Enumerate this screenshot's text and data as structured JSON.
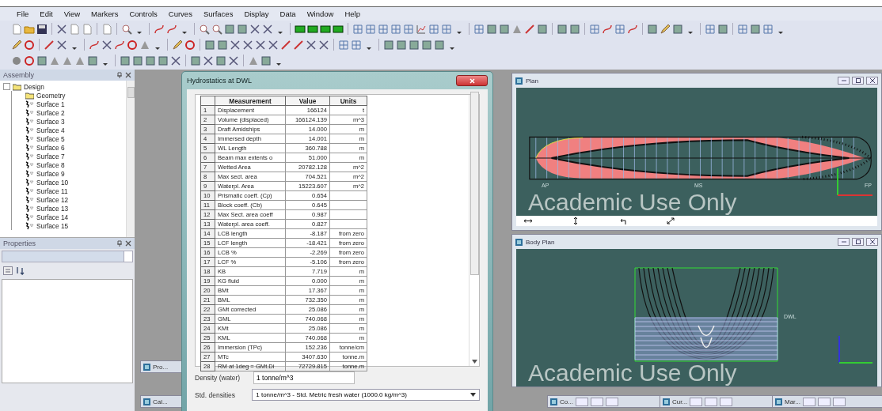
{
  "menu": [
    "File",
    "Edit",
    "View",
    "Markers",
    "Controls",
    "Curves",
    "Surfaces",
    "Display",
    "Data",
    "Window",
    "Help"
  ],
  "assembly": {
    "title": "Assembly",
    "tree": [
      {
        "label": "Design",
        "kind": "folder",
        "expanded": true,
        "children": [
          {
            "label": "Geometry",
            "kind": "folder"
          },
          {
            "label": "Surface 1",
            "kind": "surface"
          },
          {
            "label": "Surface 2",
            "kind": "surface"
          },
          {
            "label": "Surface 3",
            "kind": "surface"
          },
          {
            "label": "Surface 4",
            "kind": "surface"
          },
          {
            "label": "Surface 5",
            "kind": "surface"
          },
          {
            "label": "Surface 6",
            "kind": "surface"
          },
          {
            "label": "Surface 7",
            "kind": "surface"
          },
          {
            "label": "Surface 8",
            "kind": "surface"
          },
          {
            "label": "Surface 9",
            "kind": "surface"
          },
          {
            "label": "Surface 10",
            "kind": "surface"
          },
          {
            "label": "Surface 11",
            "kind": "surface"
          },
          {
            "label": "Surface 12",
            "kind": "surface"
          },
          {
            "label": "Surface 13",
            "kind": "surface"
          },
          {
            "label": "Surface 14",
            "kind": "surface"
          },
          {
            "label": "Surface 15",
            "kind": "surface"
          }
        ]
      }
    ]
  },
  "properties": {
    "title": "Properties"
  },
  "minimized_left": [
    {
      "title": "Pro..."
    },
    {
      "title": "Cal..."
    }
  ],
  "dialog": {
    "title": "Hydrostatics at DWL",
    "table": {
      "columns": [
        "Measurement",
        "Value",
        "Units"
      ],
      "rows": [
        {
          "index": "1",
          "measurement": "Displacement",
          "value": "166124",
          "units": "t"
        },
        {
          "index": "2",
          "measurement": "Volume (displaced)",
          "value": "166124.139",
          "units": "m^3"
        },
        {
          "index": "3",
          "measurement": "Draft Amidships",
          "value": "14.000",
          "units": "m"
        },
        {
          "index": "4",
          "measurement": "Immersed depth",
          "value": "14.001",
          "units": "m"
        },
        {
          "index": "5",
          "measurement": "WL Length",
          "value": "360.788",
          "units": "m"
        },
        {
          "index": "6",
          "measurement": "Beam max extents o",
          "value": "51.000",
          "units": "m"
        },
        {
          "index": "7",
          "measurement": "Wetted Area",
          "value": "20782.128",
          "units": "m^2"
        },
        {
          "index": "8",
          "measurement": "Max sect. area",
          "value": "704.521",
          "units": "m^2"
        },
        {
          "index": "9",
          "measurement": "Waterpl. Area",
          "value": "15223.607",
          "units": "m^2"
        },
        {
          "index": "10",
          "measurement": "Prismatic coeff. (Cp)",
          "value": "0.654",
          "units": ""
        },
        {
          "index": "11",
          "measurement": "Block coeff. (Cb)",
          "value": "0.645",
          "units": ""
        },
        {
          "index": "12",
          "measurement": "Max Sect. area coeff",
          "value": "0.987",
          "units": ""
        },
        {
          "index": "13",
          "measurement": "Waterpl. area coeff.",
          "value": "0.827",
          "units": ""
        },
        {
          "index": "14",
          "measurement": "LCB length",
          "value": "-8.187",
          "units": "from zero"
        },
        {
          "index": "15",
          "measurement": "LCF length",
          "value": "-18.421",
          "units": "from zero"
        },
        {
          "index": "16",
          "measurement": "LCB %",
          "value": "-2.269",
          "units": "from zero"
        },
        {
          "index": "17",
          "measurement": "LCF %",
          "value": "-5.106",
          "units": "from zero"
        },
        {
          "index": "18",
          "measurement": "KB",
          "value": "7.719",
          "units": "m"
        },
        {
          "index": "19",
          "measurement": "KG fluid",
          "value": "0.000",
          "units": "m"
        },
        {
          "index": "20",
          "measurement": "BMt",
          "value": "17.367",
          "units": "m"
        },
        {
          "index": "21",
          "measurement": "BML",
          "value": "732.350",
          "units": "m"
        },
        {
          "index": "22",
          "measurement": "GMt corrected",
          "value": "25.086",
          "units": "m"
        },
        {
          "index": "23",
          "measurement": "GML",
          "value": "740.068",
          "units": "m"
        },
        {
          "index": "24",
          "measurement": "KMt",
          "value": "25.086",
          "units": "m"
        },
        {
          "index": "25",
          "measurement": "KML",
          "value": "740.068",
          "units": "m"
        },
        {
          "index": "26",
          "measurement": "Immersion (TPc)",
          "value": "152.236",
          "units": "tonne/cm"
        },
        {
          "index": "27",
          "measurement": "MTc",
          "value": "3407.630",
          "units": "tonne.m"
        },
        {
          "index": "28",
          "measurement": "RM at 1deg = GMt.Di",
          "value": "72729.815",
          "units": "tonne.m"
        }
      ]
    },
    "density": {
      "label": "Density (water)",
      "value": "1 tonne/m^3"
    },
    "std_densities": {
      "label": "Std. densities",
      "value": "1 tonne/m^3 - Std. Metric fresh water (1000.0 kg/m^3)"
    }
  },
  "views": [
    {
      "kind": "plan",
      "title": "Plan",
      "labels": [
        "AP",
        "MS",
        "FP"
      ],
      "watermark": "Academic Use Only"
    },
    {
      "kind": "body",
      "title": "Body Plan",
      "labels": [
        "DWL"
      ],
      "watermark": "Academic Use Only"
    }
  ],
  "minimized_bottom": [
    {
      "title": "Co..."
    },
    {
      "title": "Cur..."
    },
    {
      "title": "Mar..."
    }
  ]
}
